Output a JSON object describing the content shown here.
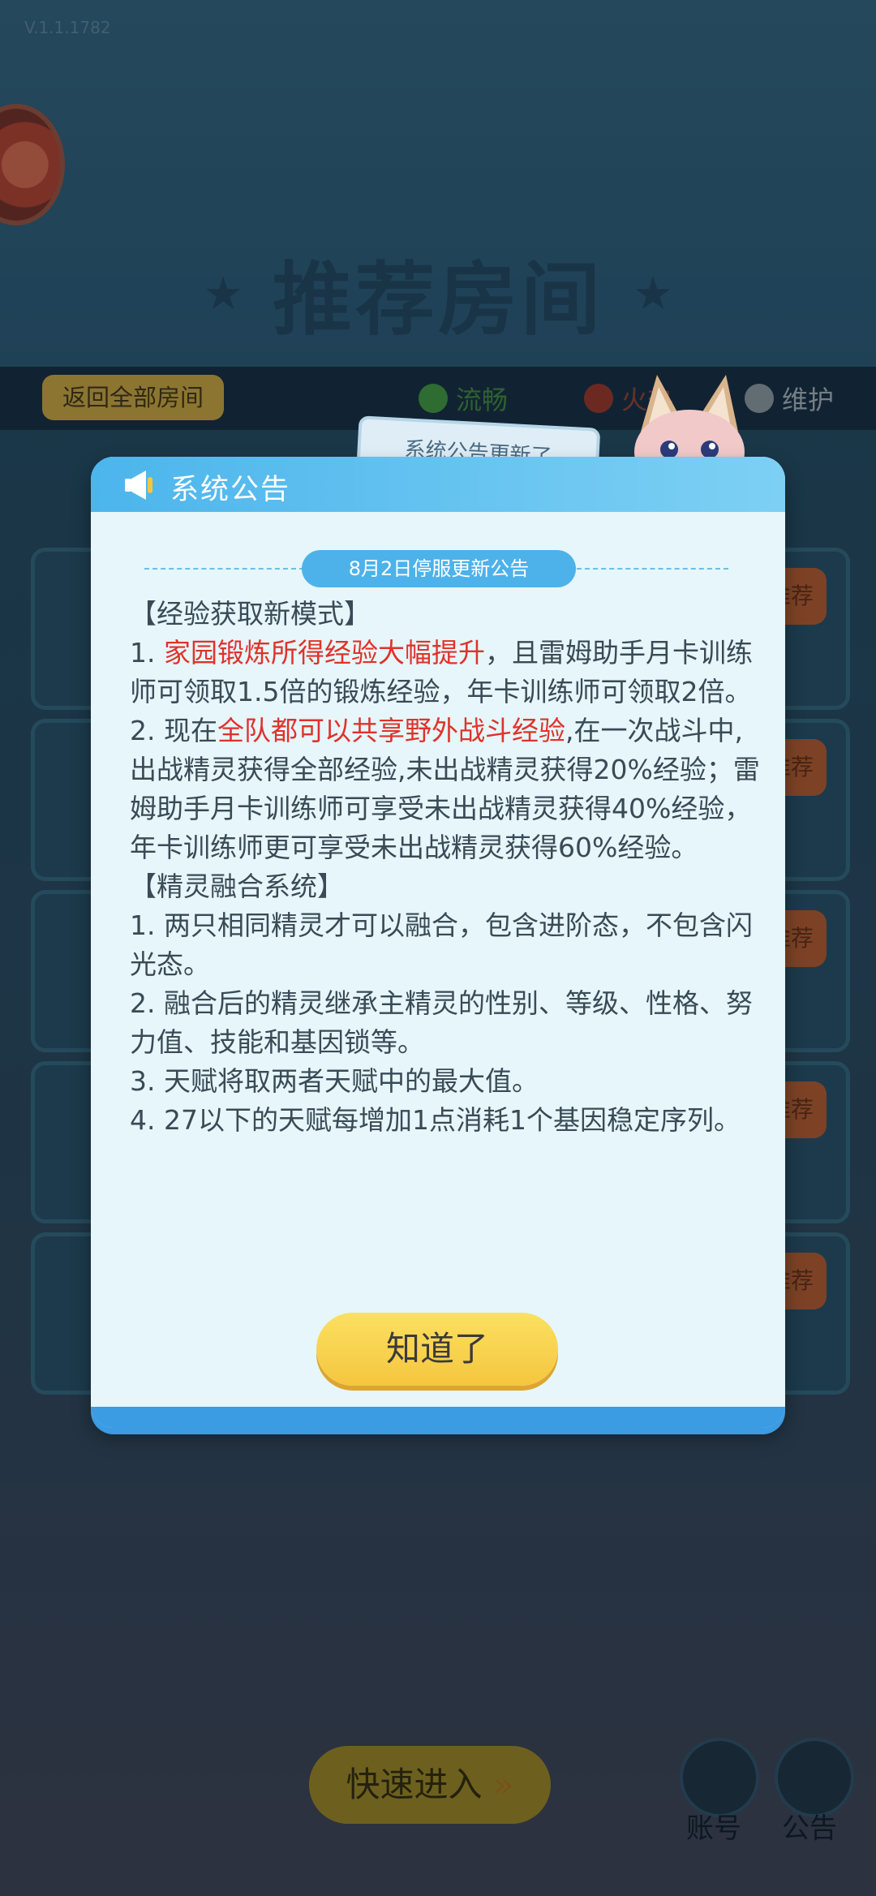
{
  "app": {
    "version": "V.1.1.1782"
  },
  "background": {
    "title": "推荐房间",
    "back_button": "返回全部房间",
    "status_legend": [
      {
        "label": "流畅"
      },
      {
        "label": "火热"
      },
      {
        "label": "维护"
      }
    ],
    "room_badge": "推荐",
    "quick_enter_button": "快速进入",
    "bottom_buttons": [
      {
        "label": "账号",
        "icon": "robot-avatar-icon"
      },
      {
        "label": "公告",
        "icon": "megaphone-icon"
      }
    ],
    "peek_text": "系统公告更新了"
  },
  "dialog": {
    "title": "系统公告",
    "notice_title": "8月2日停服更新公告",
    "sections": [
      {
        "heading": "【经验获取新模式】"
      },
      {
        "heading": "【精灵融合系统】"
      }
    ],
    "paragraphs": {
      "exp_1_prefix": "1. ",
      "exp_1_highlight": "家园锻炼所得经验大幅提升",
      "exp_1_rest": "，且雷姆助手月卡训练师可领取1.5倍的锻炼经验，年卡训练师可领取2倍。",
      "exp_2_prefix": "2. 现在",
      "exp_2_highlight": "全队都可以共享野外战斗经验",
      "exp_2_rest": ",在一次战斗中,出战精灵获得全部经验,未出战精灵获得20%经验；雷姆助手月卡训练师可享受未出战精灵获得40%经验，年卡训练师更可享受未出战精灵获得60%经验。",
      "fuse_1": "1. 两只相同精灵才可以融合，包含进阶态，不包含闪光态。",
      "fuse_2": "2. 融合后的精灵继承主精灵的性别、等级、性格、努力值、技能和基因锁等。",
      "fuse_3": "3. 天赋将取两者天赋中的最大值。",
      "fuse_4": "4. 27以下的天赋每增加1点消耗1个基因稳定序列。"
    },
    "ok_button": "知道了"
  },
  "colors": {
    "highlight": "#e0322b",
    "header": "#4cb5ec",
    "button": "#f5c63f"
  }
}
